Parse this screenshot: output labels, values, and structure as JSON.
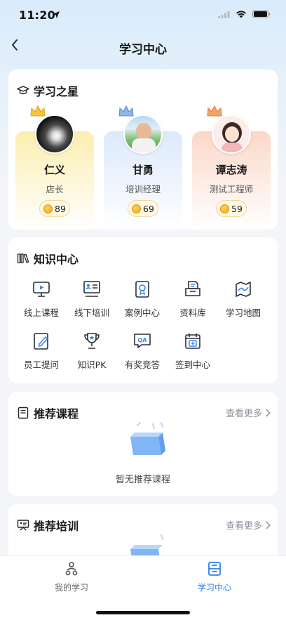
{
  "status_bar": {
    "time": "11:20"
  },
  "nav": {
    "title": "学习中心"
  },
  "stars_section": {
    "title": "学习之星",
    "members": [
      {
        "name": "仁义",
        "role": "店长",
        "points": "89",
        "bg": "#fbeeb0"
      },
      {
        "name": "甘勇",
        "role": "培训经理",
        "points": "69",
        "bg": "#dce9fb"
      },
      {
        "name": "谭志涛",
        "role": "测试工程师",
        "points": "59",
        "bg": "#fbd8c8"
      }
    ]
  },
  "knowledge_section": {
    "title": "知识中心",
    "items": [
      {
        "label": "线上课程",
        "icon": "video-icon"
      },
      {
        "label": "线下培训",
        "icon": "classroom-icon"
      },
      {
        "label": "案例中心",
        "icon": "case-icon"
      },
      {
        "label": "资料库",
        "icon": "archive-icon"
      },
      {
        "label": "学习地图",
        "icon": "map-icon"
      },
      {
        "label": "员工提问",
        "icon": "question-edit-icon"
      },
      {
        "label": "知识PK",
        "icon": "trophy-icon"
      },
      {
        "label": "有奖竞答",
        "icon": "qa-icon"
      },
      {
        "label": "签到中心",
        "icon": "calendar-sign-icon"
      }
    ]
  },
  "recommended_courses": {
    "title": "推荐课程",
    "more": "查看更多",
    "empty_text": "暂无推荐课程"
  },
  "recommended_training": {
    "title": "推荐培训",
    "more": "查看更多"
  },
  "tabbar": {
    "tabs": [
      {
        "label": "我的学习",
        "active": false
      },
      {
        "label": "学习中心",
        "active": true
      }
    ],
    "active_color": "#2f80ed",
    "inactive_color": "#666666"
  }
}
